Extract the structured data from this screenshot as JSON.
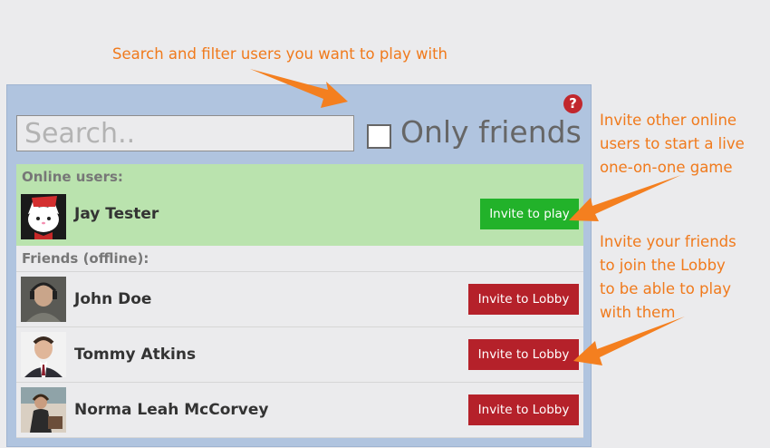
{
  "annotations": {
    "top": "Search and filter users you want to play with",
    "invite_online": [
      "Invite other online",
      "users to start a live",
      "one-on-one game"
    ],
    "invite_friends": [
      "Invite your friends",
      "to join the Lobby",
      "to be able to play",
      "with them"
    ]
  },
  "search": {
    "placeholder": "Search..",
    "value": ""
  },
  "filter": {
    "label": "Only friends",
    "checked": false
  },
  "help": {
    "label": "?"
  },
  "online": {
    "title": "Online users:",
    "users": [
      {
        "name": "Jay Tester",
        "action": "Invite to play"
      }
    ]
  },
  "offline": {
    "title": "Friends (offline):",
    "users": [
      {
        "name": "John Doe",
        "action": "Invite to Lobby"
      },
      {
        "name": "Tommy Atkins",
        "action": "Invite to Lobby"
      },
      {
        "name": "Norma Leah McCorvey",
        "action": "Invite to Lobby"
      }
    ]
  },
  "colors": {
    "annotation": "#f07a1c",
    "panel": "#b0c4df",
    "online_bg": "#bae3ae",
    "play_button": "#22b22a",
    "lobby_button": "#b5212a",
    "help_icon": "#c1272d"
  }
}
